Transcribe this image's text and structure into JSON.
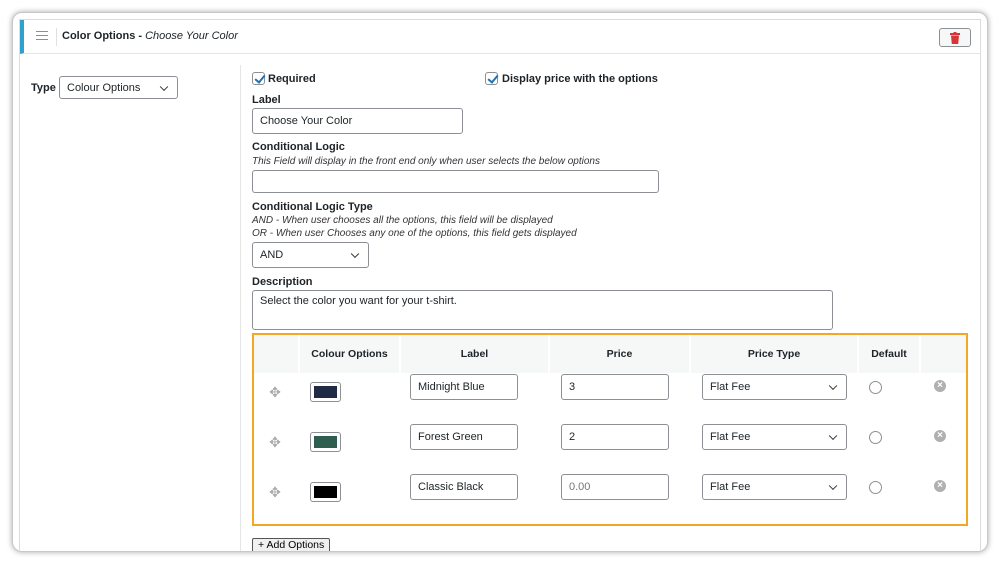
{
  "header": {
    "title": "Color Options",
    "separator": " - ",
    "subtitle": "Choose Your Color"
  },
  "type": {
    "label": "Type",
    "value": "Colour Options"
  },
  "required": {
    "label": "Required",
    "checked": true
  },
  "display_price": {
    "label": "Display price with the options",
    "checked": true
  },
  "label_field": {
    "label": "Label",
    "value": "Choose Your Color"
  },
  "conditional": {
    "label": "Conditional Logic",
    "help": "This Field will display in the front end only when user selects the below options",
    "value": ""
  },
  "logic_type": {
    "label": "Conditional Logic Type",
    "help_and": "AND - When user chooses all the options, this field will be displayed",
    "help_or": "OR - When user Chooses any one of the options, this field gets displayed",
    "value": "AND"
  },
  "description": {
    "label": "Description",
    "value": "Select the color you want for your t-shirt."
  },
  "table": {
    "headers": [
      "Colour Options",
      "Label",
      "Price",
      "Price Type",
      "Default"
    ],
    "rows": [
      {
        "color": "#1f2a44",
        "label": "Midnight Blue",
        "price": "3",
        "price_placeholder": "",
        "price_type": "Flat Fee"
      },
      {
        "color": "#2e5e4e",
        "label": "Forest Green",
        "price": "2",
        "price_placeholder": "",
        "price_type": "Flat Fee"
      },
      {
        "color": "#000000",
        "label": "Classic Black",
        "price": "",
        "price_placeholder": "0.00",
        "price_type": "Flat Fee"
      }
    ]
  },
  "add_button": "+ Add Options",
  "colors": {
    "accent": "#2ea2cc",
    "highlight": "#f5a623",
    "delete": "#d63638"
  }
}
